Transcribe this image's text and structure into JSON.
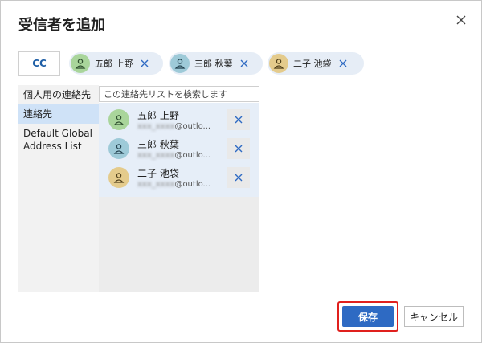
{
  "dialog": {
    "title": "受信者を追加",
    "close_icon": "close-icon"
  },
  "recipients": {
    "field_label": "CC",
    "chips": [
      {
        "name": "五郎 上野",
        "avatar_color": "#a9d59b"
      },
      {
        "name": "三郎 秋葉",
        "avatar_color": "#9ecad8"
      },
      {
        "name": "二子 池袋",
        "avatar_color": "#e4cb8c"
      }
    ]
  },
  "sidebar": {
    "items": [
      {
        "label": "個人用の連絡先"
      },
      {
        "label": "連絡先",
        "selected": true
      },
      {
        "label": "Default Global Address List"
      }
    ]
  },
  "search": {
    "placeholder": "この連絡先リストを検索します"
  },
  "contacts": [
    {
      "name": "五郎 上野",
      "email_domain": "@outlo...",
      "avatar_color": "#a9d59b"
    },
    {
      "name": "三郎 秋葉",
      "email_domain": "@outlo...",
      "avatar_color": "#9ecad8"
    },
    {
      "name": "二子 池袋",
      "email_domain": "@outlo...",
      "avatar_color": "#e4cb8c"
    }
  ],
  "footer": {
    "save_label": "保存",
    "cancel_label": "キャンセル"
  },
  "colors": {
    "accent": "#2e6ac3",
    "highlight_border": "#e0201d"
  }
}
